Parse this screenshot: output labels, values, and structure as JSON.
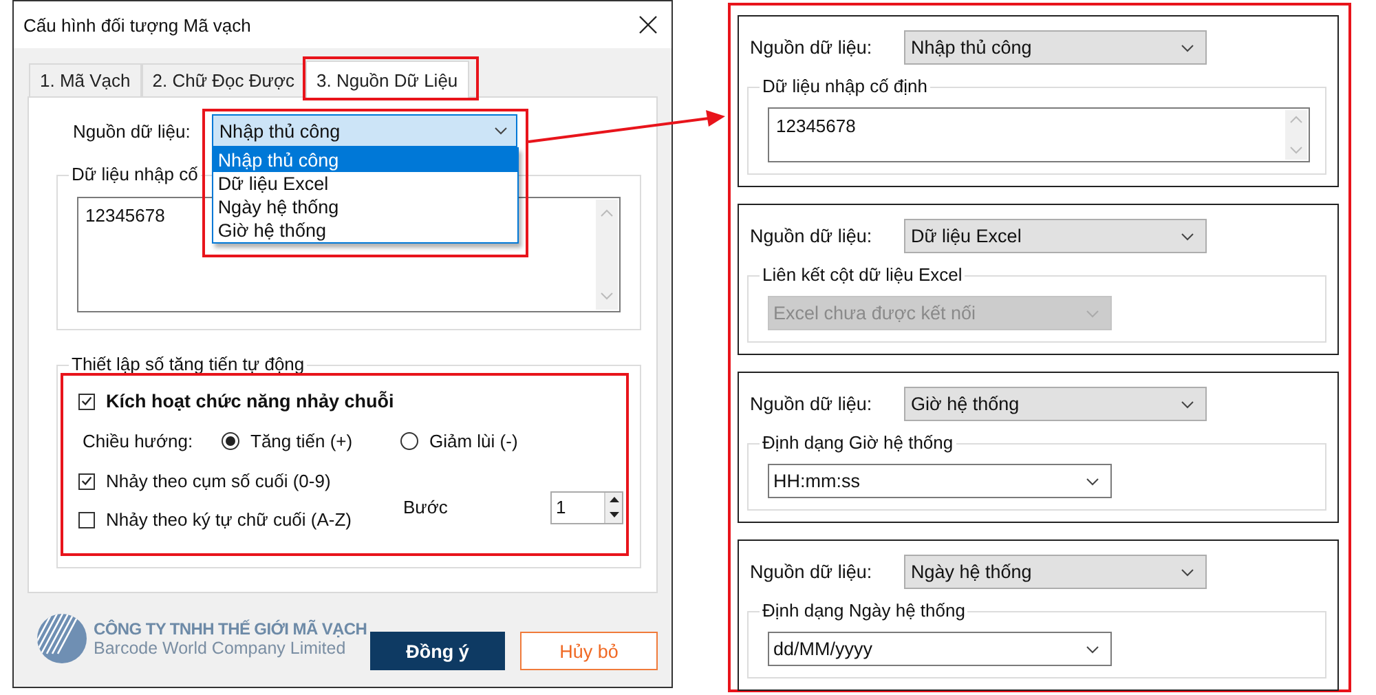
{
  "window": {
    "title": "Cấu hình đối tượng Mã vạch"
  },
  "tabs": [
    {
      "label": "1. Mã Vạch",
      "selected": false
    },
    {
      "label": "2. Chữ Đọc Được",
      "selected": false
    },
    {
      "label": "3. Nguồn Dữ Liệu",
      "selected": true
    }
  ],
  "source": {
    "label": "Nguồn dữ liệu:",
    "value": "Nhập thủ công",
    "expanded": true,
    "options": [
      {
        "label": "Nhập thủ công",
        "selected": true
      },
      {
        "label": "Dữ liệu Excel",
        "selected": false
      },
      {
        "label": "Ngày hệ thống",
        "selected": false
      },
      {
        "label": "Giờ hệ thống",
        "selected": false
      }
    ]
  },
  "fixed_group": {
    "title": "Dữ liệu nhập cố",
    "value": "12345678"
  },
  "auto_group": {
    "title": "Thiết lập số tăng tiến tự động",
    "enable": {
      "label": "Kích hoạt chức năng nhảy chuỗi",
      "checked": true
    },
    "direction_label": "Chiều hướng:",
    "directions": [
      {
        "label": "Tăng tiến (+)",
        "selected": true
      },
      {
        "label": "Giảm lùi (-)",
        "selected": false
      }
    ],
    "options": [
      {
        "label": "Nhảy theo cụm số cuối (0-9)",
        "checked": true
      },
      {
        "label": "Nhảy theo ký tự chữ cuối (A-Z)",
        "checked": false
      }
    ],
    "step_label": "Bước",
    "step_value": "1"
  },
  "brand": {
    "name": "CÔNG TY TNHH THẾ GIỚI MÃ VẠCH",
    "subtitle": "Barcode World Company Limited"
  },
  "buttons": [
    {
      "label": "Đồng ý",
      "kind": "primary"
    },
    {
      "label": "Hủy bỏ",
      "kind": "secondary"
    }
  ],
  "examples": [
    {
      "source_label": "Nguồn dữ liệu:",
      "source_value": "Nhập thủ công",
      "group_title": "Dữ liệu nhập cố định",
      "kind": "textarea",
      "value": "12345678",
      "disabled": false
    },
    {
      "source_label": "Nguồn dữ liệu:",
      "source_value": "Dữ liệu Excel",
      "group_title": "Liên kết cột dữ liệu Excel",
      "kind": "select",
      "value": "Excel chưa được kết nối",
      "disabled": true
    },
    {
      "source_label": "Nguồn dữ liệu:",
      "source_value": "Giờ hệ thống",
      "group_title": "Định dạng Giờ hệ thống",
      "kind": "select",
      "value": "HH:mm:ss",
      "disabled": false
    },
    {
      "source_label": "Nguồn dữ liệu:",
      "source_value": "Ngày hệ thống",
      "group_title": "Định dạng Ngày hệ thống",
      "kind": "select",
      "value": "dd/MM/yyyy",
      "disabled": false
    }
  ]
}
